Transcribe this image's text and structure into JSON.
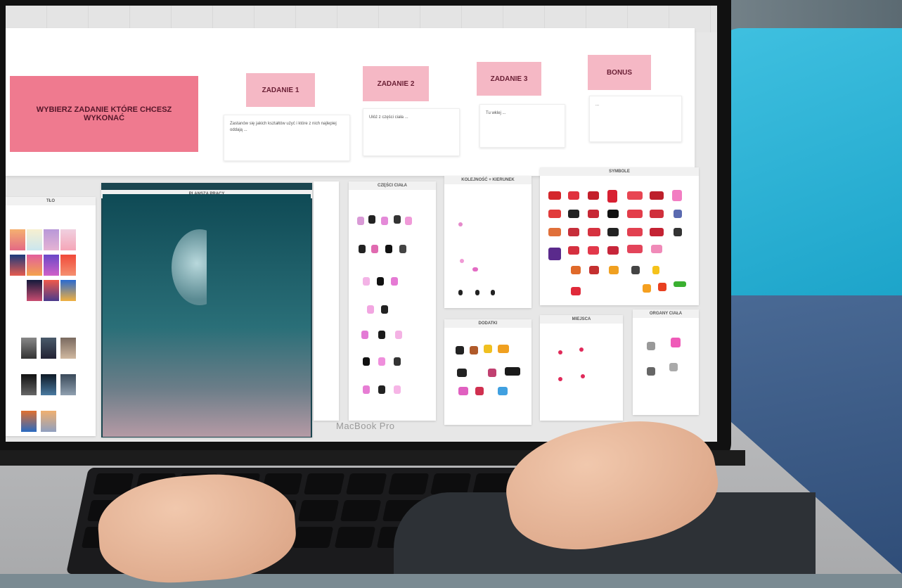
{
  "device": {
    "brand_label": "MacBook Pro"
  },
  "board": {
    "choose_title": "WYBIERZ ZADANIE KTÓRE CHCESZ WYKONAĆ",
    "tasks": [
      {
        "label": "ZADANIE 1",
        "note": "Zastanów się jakich kształtów użyć i które z nich najlepiej oddają ..."
      },
      {
        "label": "ZADANIE 2",
        "note": "Ułóż z części ciała ..."
      },
      {
        "label": "ZADANIE 3",
        "note": "Tu wklej ..."
      },
      {
        "label": "BONUS",
        "note": "..."
      }
    ]
  },
  "panels": {
    "tla": "TŁO",
    "plansza": "PLANSZA PRACY",
    "czesci": "CZĘŚCI CIAŁA",
    "kolejnosc": "KOLEJNOŚĆ + KIERUNEK",
    "symbole": "SYMBOLE",
    "dodatki": "DODATKI",
    "miejsca": "MIEJSCA",
    "organy": "ORGANY CIAŁA"
  },
  "colors": {
    "accent_pink": "#ef7a8f",
    "tag_pink": "#f5b8c5",
    "screen_bg": "#e7e7e7"
  }
}
